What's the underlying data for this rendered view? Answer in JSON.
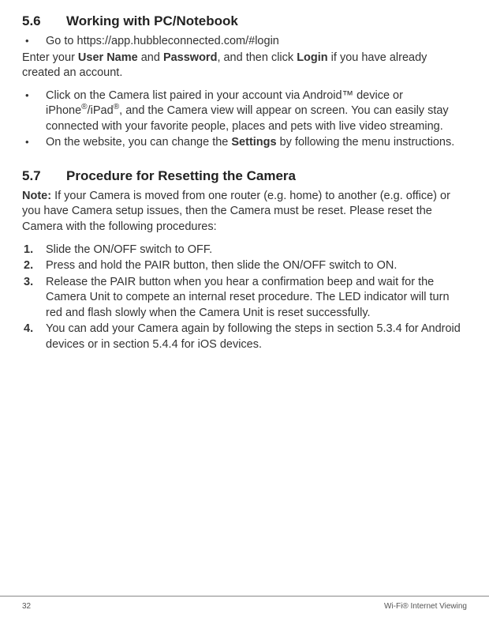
{
  "sections": {
    "s56": {
      "number": "5.6",
      "title": "Working with PC/Notebook",
      "bullet1_pre": "Go to ",
      "bullet1_url": "https://app.hubbleconnected.com/#login",
      "afterB1_pre": "Enter your ",
      "afterB1_u": "User Name",
      "afterB1_mid": " and ",
      "afterB1_p": "Password",
      "afterB1_mid2": ", and then click ",
      "afterB1_login": "Login",
      "afterB1_tail": " if you have already created an account.",
      "bullet2_pre": "Click on the Camera list paired in your account via Android™ device or iPhone",
      "bullet2_mid": "/iPad",
      "bullet2_tail": ", and the Camera view will appear on screen. You can easily stay connected with your favorite people, places and pets with live video streaming.",
      "bullet3_pre": "On the website, you can change the ",
      "bullet3_settings": "Settings",
      "bullet3_tail": " by following the menu instructions."
    },
    "s57": {
      "number": "5.7",
      "title": "Procedure for Resetting the Camera",
      "note_label": "Note:",
      "note_body": " If your Camera is moved from one router (e.g. home) to another (e.g. office) or you have Camera setup issues, then the Camera must be reset. Please reset the Camera with the following procedures:",
      "ol": [
        "Slide the ON/OFF switch to OFF.",
        "Press and hold the PAIR button, then slide the ON/OFF switch to ON.",
        "Release the PAIR button when you hear a confirmation beep and wait for the Camera Unit to compete an internal reset procedure. The LED indicator will turn red and flash slowly when the Camera Unit is reset successfully.",
        "You can add your Camera again by following the steps in section 5.3.4 for Android devices or in section 5.4.4 for iOS devices."
      ],
      "ol_nums": [
        "1.",
        "2.",
        "3.",
        "4."
      ]
    }
  },
  "footer": {
    "page": "32",
    "right": "Wi-Fi® Internet Viewing"
  },
  "glyphs": {
    "bullet": "•",
    "reg": "®"
  }
}
